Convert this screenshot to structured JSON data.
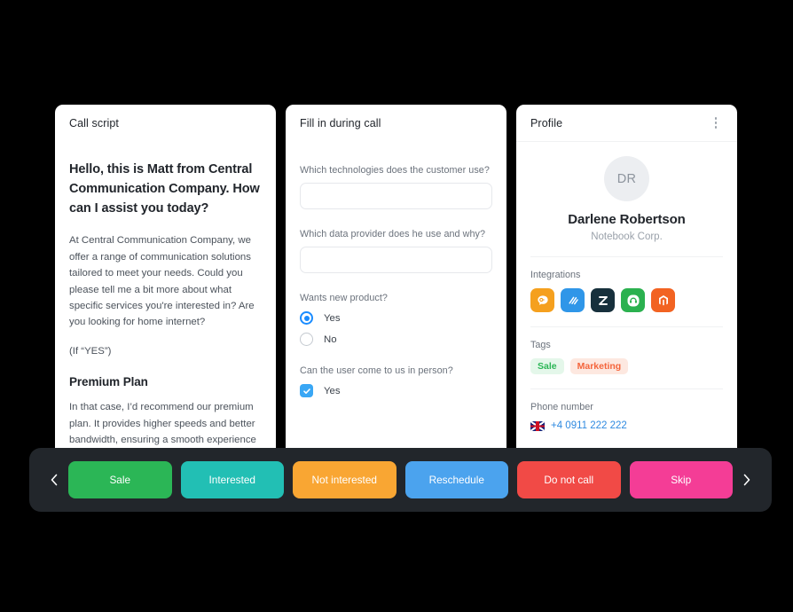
{
  "script_card": {
    "title": "Call script",
    "lead": "Hello, this is Matt from Central Communication Company. How can I assist you today?",
    "para1": "At Central Communication Company, we offer a range of communication solutions tailored to meet your needs. Could you please tell me a bit more about what specific services you're interested in? Are you looking for home internet?",
    "note": "(If “YES”)",
    "heading2": "Premium Plan",
    "para2": "In that case, I’d recommend our premium plan. It provides higher speeds and better bandwidth, ensuring a smooth experience even with multiple devices streaming"
  },
  "form_card": {
    "title": "Fill in during call",
    "fields": [
      {
        "label": "Which technologies does the customer use?",
        "value": "",
        "placeholder": ""
      },
      {
        "label": "Which data provider does he use and why?",
        "value": "",
        "placeholder": ""
      }
    ],
    "radio_group": {
      "label": "Wants new product?",
      "options": [
        {
          "label": "Yes",
          "selected": true
        },
        {
          "label": "No",
          "selected": false
        }
      ]
    },
    "checkbox_group": {
      "label": "Can the user come to us in person?",
      "options": [
        {
          "label": "Yes",
          "checked": true
        }
      ]
    }
  },
  "profile_card": {
    "title": "Profile",
    "menu_icon": "kebab-menu-icon",
    "avatar_initials": "DR",
    "name": "Darlene Robertson",
    "company": "Notebook Corp.",
    "integrations_label": "Integrations",
    "integrations": [
      {
        "name": "intercom-icon",
        "color": "#F5A01E"
      },
      {
        "name": "hubspot-icon",
        "color": "#2F96E8"
      },
      {
        "name": "zendesk-icon",
        "color": "#17303C"
      },
      {
        "name": "freshdesk-icon",
        "color": "#2BB14F"
      },
      {
        "name": "magento-icon",
        "color": "#F26322"
      }
    ],
    "tags_label": "Tags",
    "tags": [
      {
        "label": "Sale",
        "color": "#2BB656",
        "bg": "#E4F7EA"
      },
      {
        "label": "Marketing",
        "color": "#F4653C",
        "bg": "#FDE8E0"
      }
    ],
    "phone_label": "Phone number",
    "phone_number": "+4 0911 222 222",
    "phone_flag": "uk-flag-icon"
  },
  "action_bar": {
    "prev_icon": "chevron-left-icon",
    "next_icon": "chevron-right-icon",
    "buttons": [
      {
        "label": "Sale",
        "color": "#2BB656"
      },
      {
        "label": "Interested",
        "color": "#22BFB4"
      },
      {
        "label": "Not interested",
        "color": "#F9A633"
      },
      {
        "label": "Reschedule",
        "color": "#4BA3EE"
      },
      {
        "label": "Do not call",
        "color": "#F14A46"
      },
      {
        "label": "Skip",
        "color": "#F43D96"
      }
    ]
  }
}
